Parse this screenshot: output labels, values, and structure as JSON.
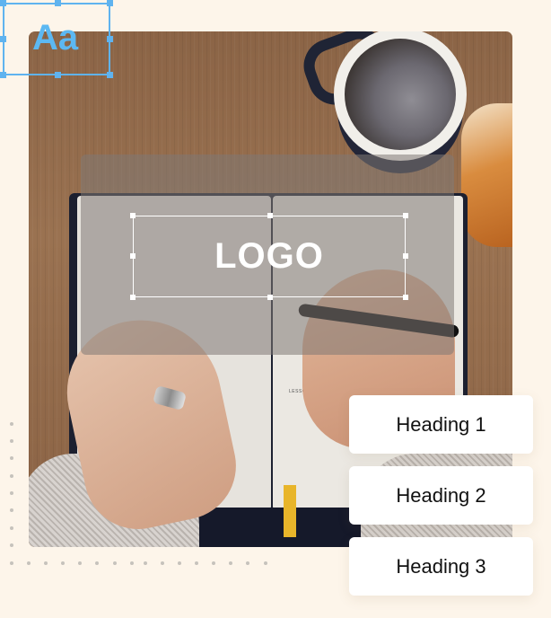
{
  "canvas": {
    "background_color": "#fdf5ea",
    "photo": {
      "description": "Overhead view of hands writing in a notebook on a wooden table with coffee mug and croissant",
      "notebook_text": "LESSONS LEARNED"
    },
    "logo_placeholder": {
      "label": "LOGO",
      "overlay_color": "#807874",
      "selected": true
    },
    "typography_element": {
      "label": "Aa",
      "accent_color": "#5cb8f2",
      "selected": true
    }
  },
  "heading_styles": [
    {
      "label": "Heading 1"
    },
    {
      "label": "Heading 2"
    },
    {
      "label": "Heading 3"
    }
  ]
}
